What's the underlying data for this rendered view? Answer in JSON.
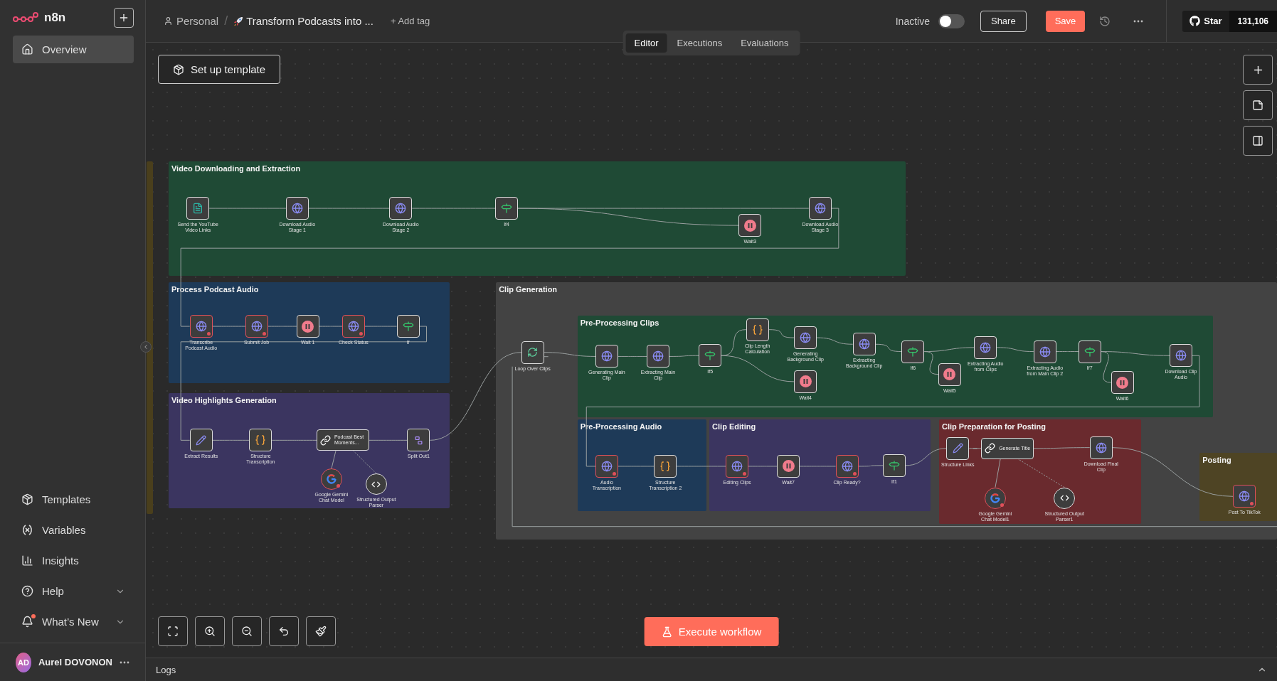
{
  "sidebar": {
    "logo": "n8n",
    "items": [
      {
        "label": "Overview",
        "selected": true
      }
    ],
    "bottom_items": [
      {
        "label": "Templates",
        "kind": "templates",
        "expandable": false,
        "notification": false
      },
      {
        "label": "Variables",
        "kind": "variables",
        "expandable": false,
        "notification": false
      },
      {
        "label": "Insights",
        "kind": "insights",
        "expandable": false,
        "notification": false
      },
      {
        "label": "Help",
        "kind": "help",
        "expandable": true,
        "notification": false
      },
      {
        "label": "What’s New",
        "kind": "news",
        "expandable": true,
        "notification": true
      }
    ],
    "user": {
      "initials": "AD",
      "name": "Aurel DOVONON"
    }
  },
  "header": {
    "project": "Personal",
    "separator": "/",
    "workflow_title": "Transform Podcasts into ...",
    "add_tag": "+ Add tag",
    "status_label": "Inactive",
    "active": false,
    "share": "Share",
    "save": "Save",
    "github": {
      "label": "Star",
      "count": "131,106"
    }
  },
  "view_tabs": [
    {
      "label": "Editor",
      "selected": true
    },
    {
      "label": "Executions",
      "selected": false
    },
    {
      "label": "Evaluations",
      "selected": false
    }
  ],
  "canvas": {
    "setup_template": "Set up template",
    "groups": [
      {
        "color": "#4a3f1c"
      },
      {
        "title": "Video Downloading and Extraction",
        "color": "#1f4a35"
      },
      {
        "title": "Process Podcast Audio",
        "color": "#1e3a58"
      },
      {
        "title": "Video Highlights Generation",
        "color": "#3b3560"
      },
      {
        "title": "Clip Generation",
        "color": "#434343"
      },
      {
        "title": "Pre-Processing Clips",
        "color": "#1f4a35"
      },
      {
        "title": "Pre-Processing Audio",
        "color": "#1e3a58"
      },
      {
        "title": "Clip Editing",
        "color": "#3b3560"
      },
      {
        "title": "Clip Preparation for Posting",
        "color": "#6a2a2e"
      },
      {
        "title": "Posting",
        "color": "#4e4424"
      }
    ],
    "nodes": [
      {
        "name": "Send the YouTube Video Links",
        "kind": "trigger",
        "error": false
      },
      {
        "name": "Download Audio Stage 1",
        "kind": "http",
        "error": false
      },
      {
        "name": "Download Audio Stage 2",
        "kind": "http",
        "error": false
      },
      {
        "name": "If4",
        "kind": "if",
        "error": false
      },
      {
        "name": "Wait3",
        "kind": "wait",
        "error": false
      },
      {
        "name": "Download Audio Stage 3",
        "kind": "http",
        "error": false
      },
      {
        "name": "Transcribe Podcast Audio",
        "kind": "http",
        "error": true
      },
      {
        "name": "Submit Job",
        "kind": "http",
        "error": true
      },
      {
        "name": "Wait 1",
        "kind": "wait",
        "error": false
      },
      {
        "name": "Check Status",
        "kind": "http",
        "error": true
      },
      {
        "name": "If",
        "kind": "if",
        "error": false
      },
      {
        "name": "Extract Results",
        "kind": "set",
        "error": false
      },
      {
        "name": "Structure Transcription",
        "kind": "code",
        "error": false
      },
      {
        "name": "Podcast Best Moments...",
        "kind": "chain",
        "error": false
      },
      {
        "name": "Google Gemini Chat Model",
        "kind": "model",
        "error": true
      },
      {
        "name": "Structured Output Parser",
        "kind": "parser",
        "error": false
      },
      {
        "name": "Split Out1",
        "kind": "split",
        "error": false
      },
      {
        "name": "Loop Over Clips",
        "kind": "loop",
        "error": false
      },
      {
        "name": "Generating Main Clip",
        "kind": "http",
        "error": false
      },
      {
        "name": "Extracting Main Clip",
        "kind": "http",
        "error": false
      },
      {
        "name": "If5",
        "kind": "if",
        "error": false
      },
      {
        "name": "Clip Length Calculation",
        "kind": "code",
        "error": false
      },
      {
        "name": "Generating Background Clip",
        "kind": "http",
        "error": false
      },
      {
        "name": "Wait4",
        "kind": "wait",
        "error": false
      },
      {
        "name": "Extracting Background Clip",
        "kind": "http",
        "error": false
      },
      {
        "name": "If6",
        "kind": "if",
        "error": false
      },
      {
        "name": "Wait5",
        "kind": "wait",
        "error": false
      },
      {
        "name": "Extracting Audio from Clips",
        "kind": "http",
        "error": false
      },
      {
        "name": "Extracting Audio from Main Clip 2",
        "kind": "http",
        "error": false
      },
      {
        "name": "If7",
        "kind": "if",
        "error": false
      },
      {
        "name": "Wait6",
        "kind": "wait",
        "error": false
      },
      {
        "name": "Download Clip Audio",
        "kind": "http",
        "error": false
      },
      {
        "name": "Audio Transcription",
        "kind": "http",
        "error": true
      },
      {
        "name": "Structure Transcription 2",
        "kind": "code",
        "error": false
      },
      {
        "name": "Editing Clips",
        "kind": "http",
        "error": true
      },
      {
        "name": "Wait7",
        "kind": "wait",
        "error": false
      },
      {
        "name": "Clip Ready?",
        "kind": "http",
        "error": true
      },
      {
        "name": "If1",
        "kind": "if",
        "error": false
      },
      {
        "name": "Structure Links",
        "kind": "set",
        "error": false
      },
      {
        "name": "Generate Title",
        "kind": "chain",
        "error": false
      },
      {
        "name": "Download Final Clip",
        "kind": "http",
        "error": false
      },
      {
        "name": "Google Gemini Chat Model1",
        "kind": "model",
        "error": true
      },
      {
        "name": "Structured Output Parser1",
        "kind": "parser",
        "error": false
      },
      {
        "name": "Post To TikTok",
        "kind": "http",
        "error": true
      }
    ],
    "execute": "Execute workflow"
  },
  "logs": {
    "label": "Logs"
  }
}
